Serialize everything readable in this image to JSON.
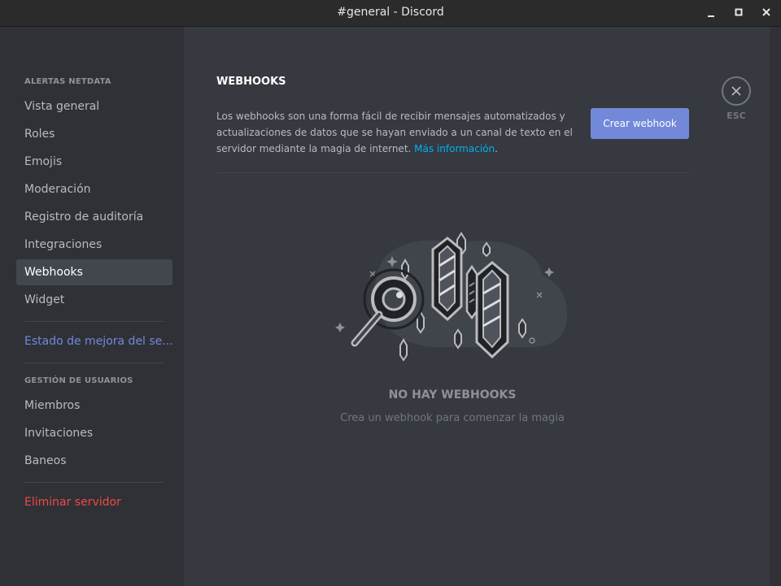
{
  "window": {
    "title": "#general - Discord"
  },
  "sidebar": {
    "section1_header": "ALERTAS NETDATA",
    "items": [
      {
        "label": "Vista general"
      },
      {
        "label": "Roles"
      },
      {
        "label": "Emojis"
      },
      {
        "label": "Moderación"
      },
      {
        "label": "Registro de auditoría"
      },
      {
        "label": "Integraciones"
      },
      {
        "label": "Webhooks",
        "selected": true
      },
      {
        "label": "Widget"
      }
    ],
    "boost_label": "Estado de mejora del se...",
    "section2_header": "GESTIÓN DE USUARIOS",
    "user_items": [
      {
        "label": "Miembros"
      },
      {
        "label": "Invitaciones"
      },
      {
        "label": "Baneos"
      }
    ],
    "delete_label": "Eliminar servidor"
  },
  "main": {
    "title": "WEBHOOKS",
    "description": "Los webhooks son una forma fácil de recibir mensajes automatizados y actualizaciones de datos que se hayan enviado a un canal de texto en el servidor mediante la magia de internet.",
    "more_info_link": "Más información",
    "description_end": ".",
    "create_button": "Crear webhook",
    "esc_label": "ESC",
    "empty_title": "NO HAY WEBHOOKS",
    "empty_subtitle": "Crea un webhook para comenzar la magia"
  },
  "colors": {
    "accent": "#7289da",
    "link": "#00b0f4",
    "danger": "#f04747",
    "sidebar_bg": "#2f3136",
    "content_bg": "#36393f"
  },
  "icons": [
    "minimize-icon",
    "maximize-icon",
    "close-icon",
    "esc-close-icon",
    "webhook-empty-illustration"
  ]
}
